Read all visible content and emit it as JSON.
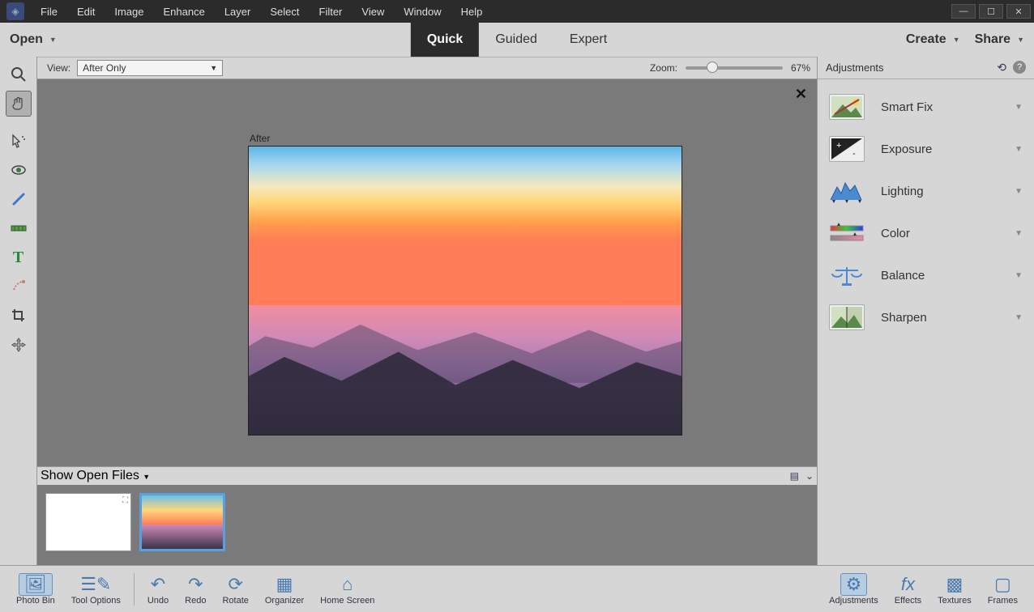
{
  "menu": [
    "File",
    "Edit",
    "Image",
    "Enhance",
    "Layer",
    "Select",
    "Filter",
    "View",
    "Window",
    "Help"
  ],
  "subbar": {
    "open": "Open",
    "modes": [
      {
        "label": "Quick",
        "active": true
      },
      {
        "label": "Guided",
        "active": false
      },
      {
        "label": "Expert",
        "active": false
      }
    ],
    "create": "Create",
    "share": "Share"
  },
  "optbar": {
    "view_label": "View:",
    "view_value": "After Only",
    "zoom_label": "Zoom:",
    "zoom_value": "67%"
  },
  "canvas": {
    "after_label": "After"
  },
  "bin": {
    "dropdown": "Show Open Files"
  },
  "panel": {
    "title": "Adjustments",
    "items": [
      "Smart Fix",
      "Exposure",
      "Lighting",
      "Color",
      "Balance",
      "Sharpen"
    ]
  },
  "footer": {
    "left": [
      "Photo Bin",
      "Tool Options",
      "Undo",
      "Redo",
      "Rotate",
      "Organizer",
      "Home Screen"
    ],
    "right": [
      "Adjustments",
      "Effects",
      "Textures",
      "Frames"
    ]
  },
  "tools": [
    "zoom",
    "hand",
    "wand",
    "eye",
    "brush",
    "level",
    "text",
    "heal",
    "crop",
    "move"
  ]
}
